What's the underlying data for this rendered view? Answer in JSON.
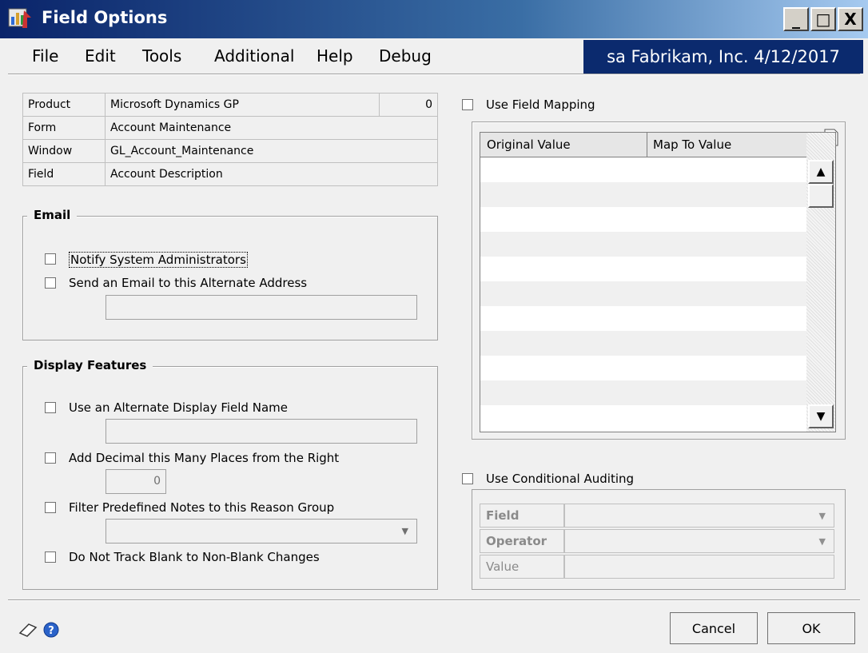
{
  "window": {
    "title": "Field Options",
    "min_label": "_",
    "max_label": "□",
    "close_label": "X"
  },
  "menu": {
    "items": [
      "File",
      "Edit",
      "Tools",
      "Additional",
      "Help",
      "Debug"
    ]
  },
  "user_banner": "sa  Fabrikam, Inc.  4/12/2017",
  "info": {
    "product_label": "Product",
    "product_value": "Microsoft Dynamics GP",
    "product_id": "0",
    "form_label": "Form",
    "form_value": "Account Maintenance",
    "window_label": "Window",
    "window_value": "GL_Account_Maintenance",
    "field_label": "Field",
    "field_value": "Account Description"
  },
  "email": {
    "title": "Email",
    "notify_label": "Notify System Administrators",
    "send_label": "Send an Email to this Alternate Address",
    "address_value": ""
  },
  "display": {
    "title": "Display Features",
    "alt_name_label": "Use an Alternate Display Field Name",
    "alt_name_value": "",
    "decimal_label": "Add Decimal this Many Places from the Right",
    "decimal_value": "0",
    "filter_label": "Filter Predefined Notes to this Reason Group",
    "filter_value": "",
    "blank_label": "Do Not Track Blank to Non-Blank Changes"
  },
  "mapping": {
    "use_label": "Use Field Mapping",
    "col_original": "Original Value",
    "col_map": "Map To Value"
  },
  "conditional": {
    "use_label": "Use Conditional Auditing",
    "field_label": "Field",
    "operator_label": "Operator",
    "value_label": "Value"
  },
  "buttons": {
    "cancel": "Cancel",
    "ok": "OK"
  },
  "colors": {
    "title_bar": "#0a246a",
    "banner": "#0b2a6e",
    "background": "#f0f0f0"
  }
}
